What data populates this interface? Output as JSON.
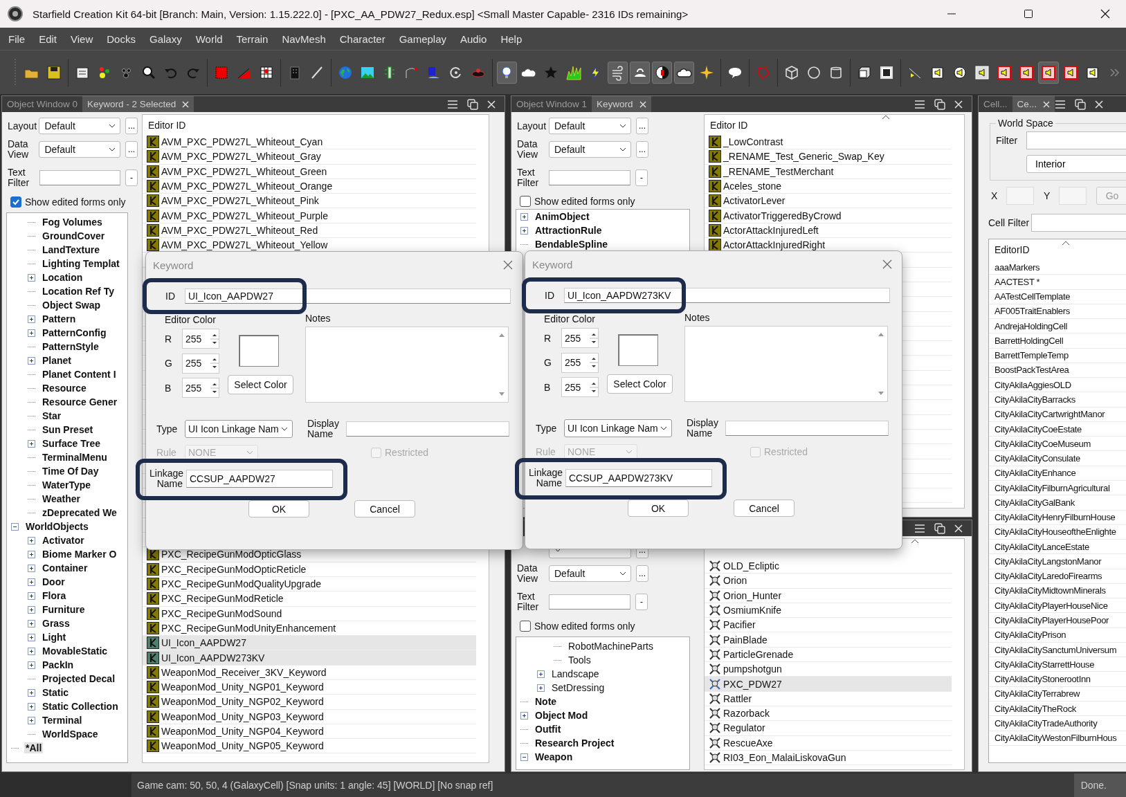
{
  "window": {
    "title": "Starfield Creation Kit 64-bit [Branch: Main, Version: 1.15.222.0] - [PXC_AA_PDW27_Redux.esp] <Small Master Capable- 2316 IDs remaining>"
  },
  "menu": [
    "File",
    "Edit",
    "View",
    "Docks",
    "Galaxy",
    "World",
    "Terrain",
    "NavMesh",
    "Character",
    "Gameplay",
    "Audio",
    "Help"
  ],
  "toolbar": [
    {
      "kind": "folder",
      "pressed": false
    },
    {
      "kind": "save",
      "pressed": false
    },
    {
      "kind": "separator"
    },
    {
      "kind": "form",
      "pressed": false
    },
    {
      "kind": "dots",
      "pressed": false
    },
    {
      "kind": "paw",
      "pressed": false
    },
    {
      "kind": "search",
      "pressed": false
    },
    {
      "kind": "undo",
      "pressed": false
    },
    {
      "kind": "redo",
      "pressed": false
    },
    {
      "kind": "separator"
    },
    {
      "kind": "red-square",
      "pressed": false
    },
    {
      "kind": "triangle",
      "pressed": false
    },
    {
      "kind": "grid",
      "pressed": false
    },
    {
      "kind": "separator"
    },
    {
      "kind": "building",
      "pressed": false
    },
    {
      "kind": "slash",
      "pressed": false
    },
    {
      "kind": "separator"
    },
    {
      "kind": "globe",
      "pressed": false
    },
    {
      "kind": "landscape",
      "pressed": false
    },
    {
      "kind": "post",
      "pressed": false
    },
    {
      "kind": "curve",
      "pressed": false
    },
    {
      "kind": "water",
      "pressed": false
    },
    {
      "kind": "rotate",
      "pressed": false
    },
    {
      "kind": "disc",
      "pressed": false
    },
    {
      "kind": "separator"
    },
    {
      "kind": "bulb",
      "pressed": true
    },
    {
      "kind": "cloud",
      "pressed": false
    },
    {
      "kind": "star",
      "pressed": false
    },
    {
      "kind": "grass",
      "pressed": false
    },
    {
      "kind": "bolt",
      "pressed": false
    },
    {
      "kind": "wind",
      "pressed": true
    },
    {
      "kind": "sun-cloud",
      "pressed": true
    },
    {
      "kind": "contrast",
      "pressed": true
    },
    {
      "kind": "cloud-outline",
      "pressed": true
    },
    {
      "kind": "sparkle",
      "pressed": false
    },
    {
      "kind": "separator"
    },
    {
      "kind": "bubble",
      "pressed": false
    },
    {
      "kind": "separator"
    },
    {
      "kind": "polygon",
      "pressed": false
    },
    {
      "kind": "separator"
    },
    {
      "kind": "cube",
      "pressed": false
    },
    {
      "kind": "circle",
      "pressed": false
    },
    {
      "kind": "cylinder",
      "pressed": false
    },
    {
      "kind": "separator"
    },
    {
      "kind": "box",
      "pressed": false
    },
    {
      "kind": "square",
      "pressed": false
    },
    {
      "kind": "separator"
    },
    {
      "kind": "cone",
      "pressed": false
    },
    {
      "kind": "speaker-box",
      "pressed": false
    },
    {
      "kind": "speaker",
      "pressed": false
    },
    {
      "kind": "speaker-frame",
      "pressed": false
    },
    {
      "kind": "speaker-red",
      "pressed": false
    },
    {
      "kind": "speaker-red",
      "pressed": false
    },
    {
      "kind": "speaker-red",
      "pressed": true
    },
    {
      "kind": "speaker-red",
      "pressed": false
    },
    {
      "kind": "speaker-box",
      "pressed": false
    },
    {
      "kind": "more",
      "pressed": false
    }
  ],
  "docks": [
    {
      "kind": "objects",
      "windows": [
        {
          "tabs": [
            {
              "label": "Object Window 0",
              "selected": false
            },
            {
              "label": "Keyword - 2 Selected",
              "selected": true
            }
          ],
          "filters": {
            "layout_label": "Layout",
            "layout": "Default",
            "layout_more": "...",
            "data_view_label": "Data View",
            "data_view": "Default",
            "data_view_more": "...",
            "text_filter_label": "Text Filter",
            "clear_button": "-",
            "show_edited_label": "Show edited forms only",
            "show_edited": true
          },
          "tree": [
            {
              "children": [
                {
                  "label": "Fog Volumes",
                  "bold": true,
                  "selected": false
                },
                {
                  "label": "GroundCover",
                  "bold": true,
                  "selected": false
                },
                {
                  "label": "LandTexture",
                  "bold": true,
                  "selected": false
                },
                {
                  "label": "Lighting Templat",
                  "bold": true,
                  "selected": false
                },
                {
                  "label": "Location",
                  "bold": true,
                  "selected": false,
                  "expanded": false
                },
                {
                  "label": "Location Ref Ty",
                  "bold": true,
                  "selected": false
                },
                {
                  "label": "Object Swap",
                  "bold": true,
                  "selected": false
                },
                {
                  "label": "Pattern",
                  "bold": true,
                  "selected": false,
                  "expanded": false
                },
                {
                  "label": "PatternConfig",
                  "bold": true,
                  "selected": false,
                  "expanded": false
                },
                {
                  "label": "PatternStyle",
                  "bold": true,
                  "selected": false
                },
                {
                  "label": "Planet",
                  "bold": true,
                  "selected": false,
                  "expanded": false
                },
                {
                  "label": "Planet Content I",
                  "bold": true,
                  "selected": false
                },
                {
                  "label": "Resource",
                  "bold": true,
                  "selected": false
                },
                {
                  "label": "Resource Gener",
                  "bold": true,
                  "selected": false
                },
                {
                  "label": "Star",
                  "bold": true,
                  "selected": false
                },
                {
                  "label": "Sun Preset",
                  "bold": true,
                  "selected": false
                },
                {
                  "label": "Surface Tree",
                  "bold": true,
                  "selected": false,
                  "expanded": false
                },
                {
                  "label": "TerminalMenu",
                  "bold": true,
                  "selected": false
                },
                {
                  "label": "Time Of Day",
                  "bold": true,
                  "selected": false
                },
                {
                  "label": "WaterType",
                  "bold": true,
                  "selected": false
                },
                {
                  "label": "Weather",
                  "bold": true,
                  "selected": false
                },
                {
                  "label": "zDeprecated We",
                  "bold": true,
                  "selected": false
                }
              ]
            },
            {
              "label": "WorldObjects",
              "bold": true,
              "selected": false,
              "expanded": true,
              "children": [
                {
                  "label": "Activator",
                  "bold": true,
                  "selected": false,
                  "expanded": false
                },
                {
                  "label": "Biome Marker O",
                  "bold": true,
                  "selected": false,
                  "expanded": false
                },
                {
                  "label": "Container",
                  "bold": true,
                  "selected": false,
                  "expanded": false
                },
                {
                  "label": "Door",
                  "bold": true,
                  "selected": false,
                  "expanded": false
                },
                {
                  "label": "Flora",
                  "bold": true,
                  "selected": false,
                  "expanded": false
                },
                {
                  "label": "Furniture",
                  "bold": true,
                  "selected": false,
                  "expanded": false
                },
                {
                  "label": "Grass",
                  "bold": true,
                  "selected": false,
                  "expanded": false
                },
                {
                  "label": "Light",
                  "bold": true,
                  "selected": false,
                  "expanded": false
                },
                {
                  "label": "MovableStatic",
                  "bold": true,
                  "selected": false,
                  "expanded": false
                },
                {
                  "label": "PackIn",
                  "bold": true,
                  "selected": false,
                  "expanded": false
                },
                {
                  "label": "Projected Decal",
                  "bold": true,
                  "selected": false
                },
                {
                  "label": "Static",
                  "bold": true,
                  "selected": false,
                  "expanded": false
                },
                {
                  "label": "Static Collection",
                  "bold": true,
                  "selected": false,
                  "expanded": false
                },
                {
                  "label": "Terminal",
                  "bold": true,
                  "selected": false,
                  "expanded": false
                },
                {
                  "label": "WorldSpace",
                  "bold": true,
                  "selected": false
                }
              ]
            },
            {
              "label": "*All",
              "bold": true,
              "selected": true
            }
          ],
          "list": {
            "header": "Editor ID",
            "groups": [
              [
                {
                  "kind": "keyword",
                  "label": "AVM_PXC_PDW27L_Whiteout_Cyan",
                  "selected": false
                },
                {
                  "kind": "keyword",
                  "label": "AVM_PXC_PDW27L_Whiteout_Gray",
                  "selected": false
                },
                {
                  "kind": "keyword",
                  "label": "AVM_PXC_PDW27L_Whiteout_Green",
                  "selected": false
                },
                {
                  "kind": "keyword",
                  "label": "AVM_PXC_PDW27L_Whiteout_Orange",
                  "selected": false
                },
                {
                  "kind": "keyword",
                  "label": "AVM_PXC_PDW27L_Whiteout_Pink",
                  "selected": false
                },
                {
                  "kind": "keyword",
                  "label": "AVM_PXC_PDW27L_Whiteout_Purple",
                  "selected": false
                },
                {
                  "kind": "keyword",
                  "label": "AVM_PXC_PDW27L_Whiteout_Red",
                  "selected": false
                },
                {
                  "kind": "keyword",
                  "label": "AVM_PXC_PDW27L_Whiteout_Yellow",
                  "selected": false
                }
              ],
              [
                {
                  "kind": "keyword",
                  "label": "PXC_RecipeGunModOpticGlass",
                  "selected": false
                },
                {
                  "kind": "keyword",
                  "label": "PXC_RecipeGunModOpticReticle",
                  "selected": false
                },
                {
                  "kind": "keyword",
                  "label": "PXC_RecipeGunModQualityUpgrade",
                  "selected": false
                },
                {
                  "kind": "keyword",
                  "label": "PXC_RecipeGunModReticle",
                  "selected": false
                },
                {
                  "kind": "keyword",
                  "label": "PXC_RecipeGunModSound",
                  "selected": false
                },
                {
                  "kind": "keyword",
                  "label": "PXC_RecipeGunModUnityEnhancement",
                  "selected": false
                },
                {
                  "kind": "keyword",
                  "label": "UI_Icon_AAPDW27",
                  "selected": true
                },
                {
                  "kind": "keyword",
                  "label": "UI_Icon_AAPDW273KV",
                  "selected": true
                },
                {
                  "kind": "keyword",
                  "label": "WeaponMod_Receiver_3KV_Keyword",
                  "selected": false
                },
                {
                  "kind": "keyword",
                  "label": "WeaponMod_Unity_NGP01_Keyword",
                  "selected": false
                },
                {
                  "kind": "keyword",
                  "label": "WeaponMod_Unity_NGP02_Keyword",
                  "selected": false
                },
                {
                  "kind": "keyword",
                  "label": "WeaponMod_Unity_NGP03_Keyword",
                  "selected": false
                },
                {
                  "kind": "keyword",
                  "label": "WeaponMod_Unity_NGP04_Keyword",
                  "selected": false
                },
                {
                  "kind": "keyword",
                  "label": "WeaponMod_Unity_NGP05_Keyword",
                  "selected": false
                }
              ]
            ]
          }
        }
      ]
    },
    {
      "kind": "objects",
      "windows": [
        {
          "tabs": [
            {
              "label": "Object Window 1",
              "selected": false
            },
            {
              "label": "Keyword",
              "selected": true
            }
          ],
          "filters": {
            "layout_label": "Layout",
            "layout": "Default",
            "layout_more": "...",
            "data_view_label": "Data View",
            "data_view": "Default",
            "data_view_more": "...",
            "text_filter_label": "Text Filter",
            "clear_button": "-",
            "show_edited_label": "Show edited forms only",
            "show_edited": false
          },
          "tree": [
            {
              "label": "AnimObject",
              "bold": true,
              "selected": false,
              "expanded": false
            },
            {
              "label": "AttractionRule",
              "bold": true,
              "selected": false,
              "expanded": false
            },
            {
              "label": "BendableSpline",
              "bold": true,
              "selected": false
            }
          ],
          "list": {
            "header": "Editor ID",
            "sort_indicator": true,
            "groups": [
              [
                {
                  "kind": "keyword",
                  "label": "_LowContrast",
                  "selected": false
                },
                {
                  "kind": "keyword",
                  "label": "_RENAME_Test_Generic_Swap_Key",
                  "selected": false
                },
                {
                  "kind": "keyword",
                  "label": "_RENAME_TestMerchant",
                  "selected": false
                },
                {
                  "kind": "keyword",
                  "label": "Aceles_stone",
                  "selected": false
                },
                {
                  "kind": "keyword",
                  "label": "ActivatorLever",
                  "selected": false
                },
                {
                  "kind": "keyword",
                  "label": "ActivatorTriggeredByCrowd",
                  "selected": false
                },
                {
                  "kind": "keyword",
                  "label": "ActorAttackInjuredLeft",
                  "selected": false
                },
                {
                  "kind": "keyword",
                  "label": "ActorAttackInjuredRight",
                  "selected": false
                }
              ]
            ]
          }
        },
        {
          "filters": {
            "layout_more": "...",
            "data_view_label": "Data View",
            "data_view": "Default",
            "data_view_more": "...",
            "text_filter_label": "Text Filter",
            "clear_button": "-",
            "show_edited_label": "Show edited forms only",
            "show_edited": false
          },
          "tree": [
            {
              "children": [
                {
                  "children": [
                    {
                      "label": "RobotMachineParts",
                      "bold": false,
                      "selected": false
                    },
                    {
                      "label": "Tools",
                      "bold": false,
                      "selected": false
                    }
                  ]
                },
                {
                  "label": "Landscape",
                  "bold": false,
                  "selected": false,
                  "expanded": false
                },
                {
                  "label": "SetDressing",
                  "bold": false,
                  "selected": false,
                  "expanded": false
                }
              ]
            },
            {
              "label": "Note",
              "bold": true,
              "selected": false
            },
            {
              "label": "Object Mod",
              "bold": true,
              "selected": false,
              "expanded": false
            },
            {
              "label": "Outfit",
              "bold": true,
              "selected": false
            },
            {
              "label": "Research Project",
              "bold": true,
              "selected": false
            },
            {
              "label": "Weapon",
              "bold": true,
              "selected": false,
              "expanded": true
            }
          ],
          "list": {
            "sort_indicator": true,
            "groups": [
              [
                {
                  "kind": "weapon",
                  "label": "OLD_Ecliptic",
                  "selected": false
                },
                {
                  "kind": "weapon",
                  "label": "Orion",
                  "selected": false
                },
                {
                  "kind": "weapon",
                  "label": "Orion_Hunter",
                  "selected": false
                },
                {
                  "kind": "weapon",
                  "label": "OsmiumKnife",
                  "selected": false
                },
                {
                  "kind": "weapon",
                  "label": "Pacifier",
                  "selected": false
                },
                {
                  "kind": "weapon",
                  "label": "PainBlade",
                  "selected": false
                },
                {
                  "kind": "weapon",
                  "label": "ParticleGrenade",
                  "selected": false
                },
                {
                  "kind": "weapon",
                  "label": "pumpshotgun",
                  "selected": false
                },
                {
                  "kind": "weapon",
                  "label": "PXC_PDW27",
                  "selected": true
                },
                {
                  "kind": "weapon",
                  "label": "Rattler",
                  "selected": false
                },
                {
                  "kind": "weapon",
                  "label": "Razorback",
                  "selected": false
                },
                {
                  "kind": "weapon",
                  "label": "Regulator",
                  "selected": false
                },
                {
                  "kind": "weapon",
                  "label": "RescueAxe",
                  "selected": false
                },
                {
                  "kind": "weapon",
                  "label": "RI03_Eon_MalaiLiskovaGun",
                  "selected": false
                }
              ]
            ]
          }
        }
      ]
    },
    {
      "kind": "cells",
      "tabs": [
        {
          "label": "Cell...",
          "selected": false
        },
        {
          "label": "Ce...",
          "selected": true
        }
      ],
      "group_label": "World Space",
      "filter_label": "Filter",
      "interior": "Interior",
      "x_label": "X",
      "y_label": "Y",
      "go": "Go",
      "go_disabled": true,
      "cell_filter_label": "Cell Filter",
      "list": {
        "header": "EditorID",
        "sort_indicator": true,
        "rows": [
          {
            "label": "aaaMarkers",
            "selected": false
          },
          {
            "label": "AACTEST *",
            "selected": false
          },
          {
            "label": "AATestCellTemplate",
            "selected": false
          },
          {
            "label": "AF005TraitEnablers",
            "selected": false
          },
          {
            "label": "AndrejaHoldingCell",
            "selected": false
          },
          {
            "label": "BarrettHoldingCell",
            "selected": false
          },
          {
            "label": "BarrettTempleTemp",
            "selected": false
          },
          {
            "label": "BoostPackTestArea",
            "selected": false
          },
          {
            "label": "CityAkilaAggiesOLD",
            "selected": false
          },
          {
            "label": "CityAkilaCityBarracks",
            "selected": false
          },
          {
            "label": "CityAkilaCityCartwrightManor",
            "selected": false
          },
          {
            "label": "CityAkilaCityCoeEstate",
            "selected": false
          },
          {
            "label": "CityAkilaCityCoeMuseum",
            "selected": false
          },
          {
            "label": "CityAkilaCityConsulate",
            "selected": false
          },
          {
            "label": "CityAkilaCityEnhance",
            "selected": false
          },
          {
            "label": "CityAkilaCityFilburnAgricultural",
            "selected": false
          },
          {
            "label": "CityAkilaCityGalBank",
            "selected": false
          },
          {
            "label": "CityAkilaCityHenryFilburnHouse",
            "selected": false
          },
          {
            "label": "CityAkilaCityHouseoftheEnlighte",
            "selected": false
          },
          {
            "label": "CityAkilaCityLanceEstate",
            "selected": false
          },
          {
            "label": "CityAkilaCityLangstonManor",
            "selected": false
          },
          {
            "label": "CityAkilaCityLaredoFirearms",
            "selected": false
          },
          {
            "label": "CityAkilaCityMidtownMinerals",
            "selected": false
          },
          {
            "label": "CityAkilaCityPlayerHouseNice",
            "selected": false
          },
          {
            "label": "CityAkilaCityPlayerHousePoor",
            "selected": false
          },
          {
            "label": "CityAkilaCityPrison",
            "selected": false
          },
          {
            "label": "CityAkilaCitySanctumUniversum",
            "selected": false
          },
          {
            "label": "CityAkilaCityStarrettHouse",
            "selected": false
          },
          {
            "label": "CityAkilaCityStonerootInn",
            "selected": false
          },
          {
            "label": "CityAkilaCityTerrabrew",
            "selected": false
          },
          {
            "label": "CityAkilaCityTheRock",
            "selected": false
          },
          {
            "label": "CityAkilaCityTradeAuthority",
            "selected": false
          },
          {
            "label": "CityAkilaCityWestonFilburnHous",
            "selected": false
          }
        ]
      }
    }
  ],
  "dialogs": [
    {
      "title": "Keyword",
      "id_label": "ID",
      "id": "UI_Icon_AAPDW27",
      "editor_color_label": "Editor Color",
      "channels": [
        {
          "label": "R",
          "value": "255"
        },
        {
          "label": "G",
          "value": "255"
        },
        {
          "label": "B",
          "value": "255"
        }
      ],
      "select_color": "Select Color",
      "notes_label": "Notes",
      "type_label": "Type",
      "type": "UI Icon Linkage Nam",
      "display_name_label": "Display Name",
      "rule_label": "Rule",
      "rule": "NONE",
      "rule_disabled": true,
      "restricted_label": "Restricted",
      "restricted": false,
      "restricted_disabled": true,
      "linkage_label": "Linkage Name",
      "linkage": "CCSUP_AAPDW27",
      "ok": "OK",
      "cancel": "Cancel",
      "highlighted": true
    },
    {
      "title": "Keyword",
      "id_label": "ID",
      "id": "UI_Icon_AAPDW273KV",
      "editor_color_label": "Editor Color",
      "channels": [
        {
          "label": "R",
          "value": "255"
        },
        {
          "label": "G",
          "value": "255"
        },
        {
          "label": "B",
          "value": "255"
        }
      ],
      "select_color": "Select Color",
      "notes_label": "Notes",
      "type_label": "Type",
      "type": "UI Icon Linkage Nam",
      "display_name_label": "Display Name",
      "rule_label": "Rule",
      "rule": "NONE",
      "rule_disabled": true,
      "restricted_label": "Restricted",
      "restricted": false,
      "restricted_disabled": true,
      "linkage_label": "Linkage Name",
      "linkage": "CCSUP_AAPDW273KV",
      "ok": "OK",
      "cancel": "Cancel",
      "highlighted": true
    }
  ],
  "status_bar": {
    "camera": "Game cam: 50, 50, 4 (GalaxyCell) [Snap units: 1 angle: 45] [WORLD] [No snap ref]",
    "state": "Done."
  }
}
